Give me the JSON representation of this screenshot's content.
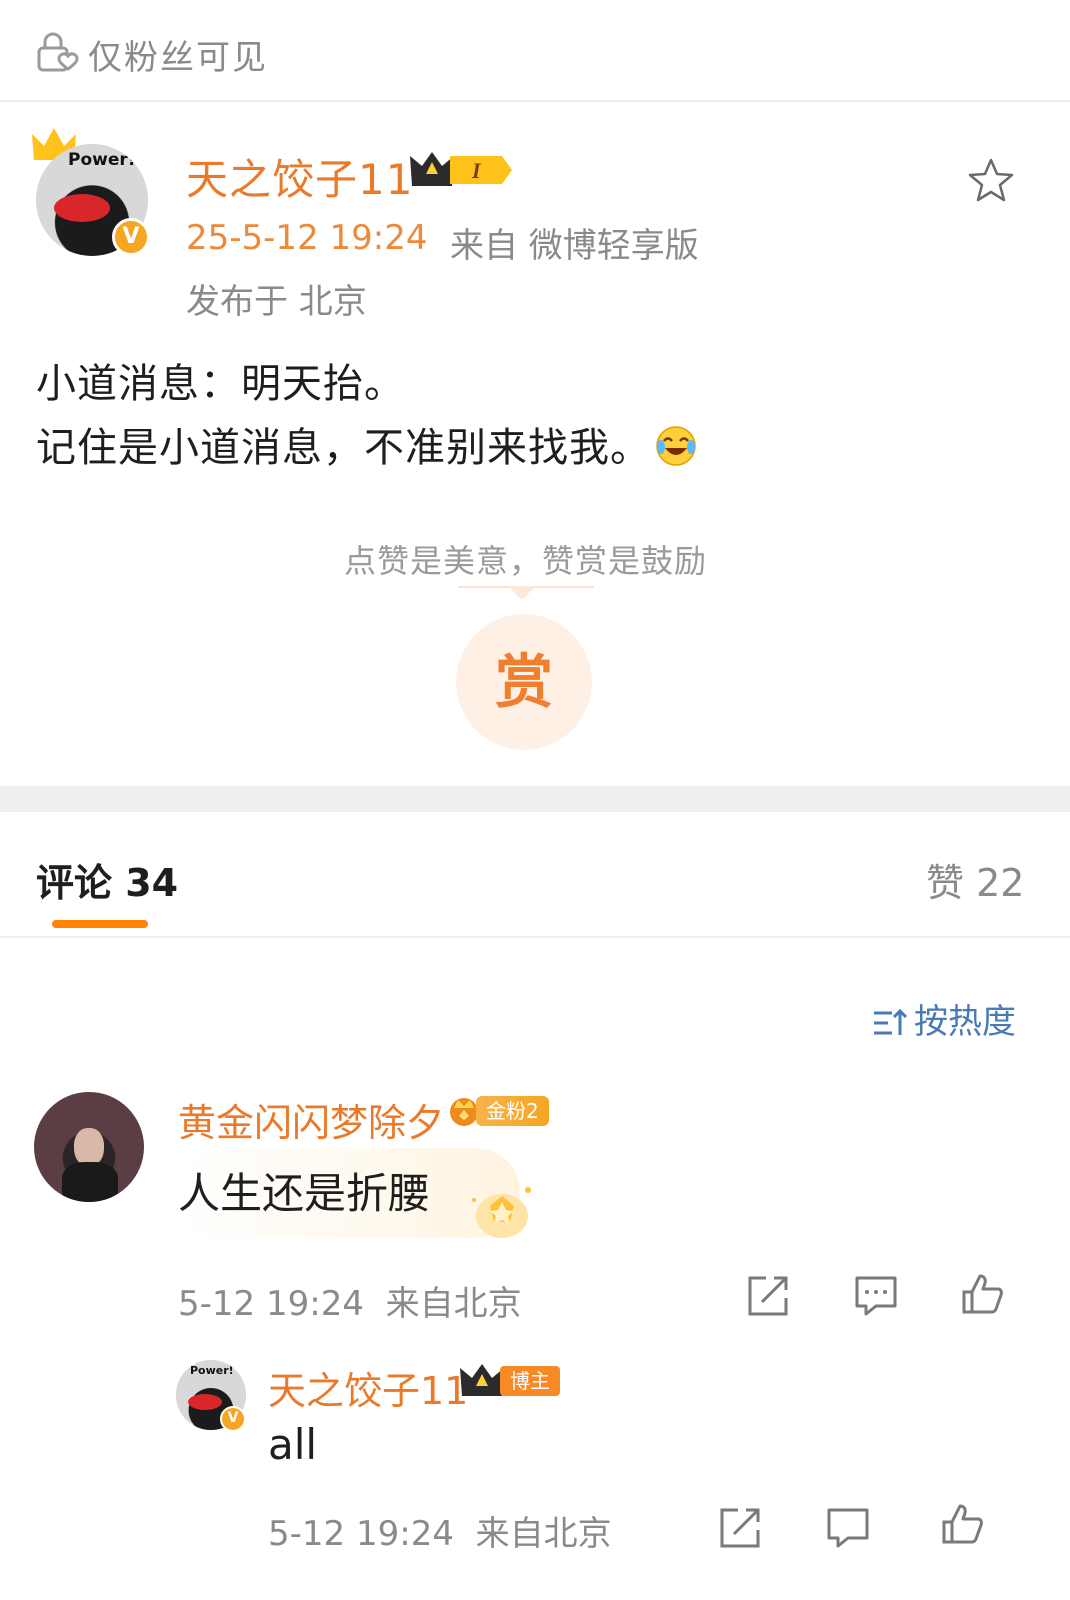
{
  "visibility": {
    "label": "仅粉丝可见"
  },
  "post": {
    "author": "天之饺子11",
    "avatar_text": "Power!",
    "level_badge": "I",
    "time": "25-5-12 19:24",
    "source": "来自 微博轻享版",
    "location": "发布于 北京",
    "lines": [
      "小道消息：明天抬。",
      "记住是小道消息，不准别来找我。"
    ],
    "emoji": "laughing-tears-emoji"
  },
  "reward": {
    "slogan": "点赞是美意，赞赏是鼓励",
    "button": "赏"
  },
  "tabs": {
    "comments": "评论 34",
    "likes": "赞 22"
  },
  "sort": {
    "label": "按热度"
  },
  "comments": [
    {
      "user": "黄金闪闪梦除夕",
      "badge": "金粉2",
      "text": "人生还是折腰",
      "meta": "5-12 19:24  来自北京",
      "replies": [
        {
          "user": "天之饺子11",
          "badge": "博主",
          "avatar_text": "Power!",
          "text": "all",
          "meta": "5-12 19:24  来自北京"
        }
      ]
    }
  ],
  "colors": {
    "accent": "#ff8200",
    "name": "#ea7a29",
    "link": "#4a7ab5",
    "muted": "#8a8a8a"
  }
}
